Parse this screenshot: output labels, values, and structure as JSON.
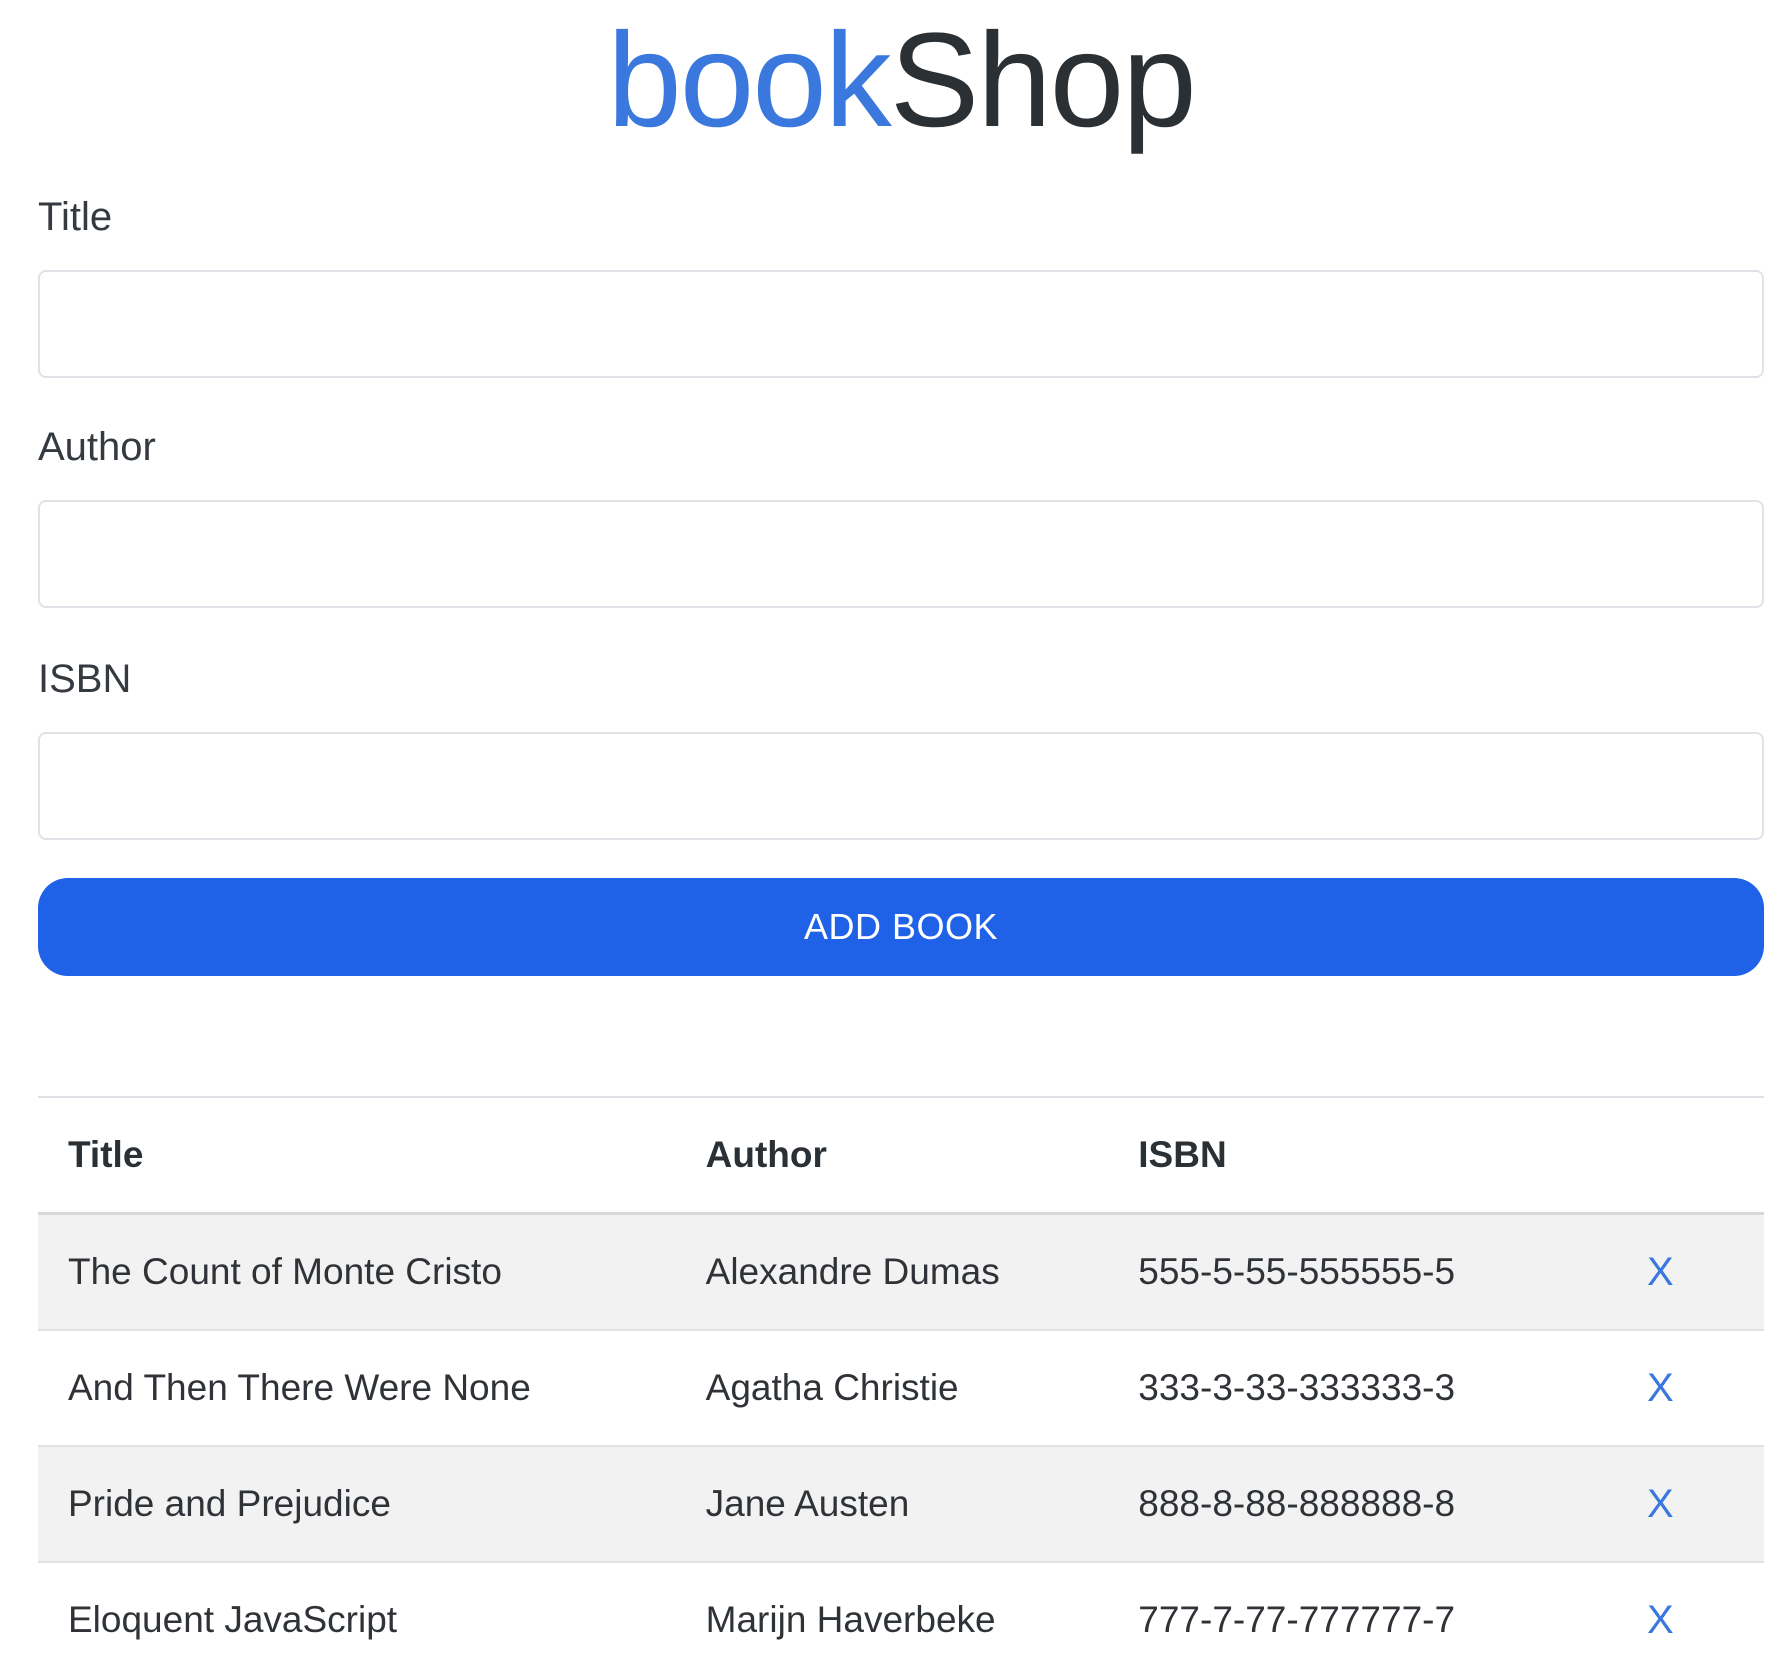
{
  "brand": {
    "part1": "book",
    "part2": "Shop",
    "colors": {
      "part1": "#3a78de",
      "part2": "#2b3035"
    }
  },
  "form": {
    "title_label": "Title",
    "title_value": "",
    "author_label": "Author",
    "author_value": "",
    "isbn_label": "ISBN",
    "isbn_value": "",
    "submit_label": "ADD BOOK",
    "submit_color": "#1f62e7"
  },
  "table": {
    "headers": [
      "Title",
      "Author",
      "ISBN"
    ],
    "rows": [
      {
        "title": "The Count of Monte Cristo",
        "author": "Alexandre Dumas",
        "isbn": "555-5-55-555555-5",
        "delete": "X"
      },
      {
        "title": "And Then There Were None",
        "author": "Agatha Christie",
        "isbn": "333-3-33-333333-3",
        "delete": "X"
      },
      {
        "title": "Pride and Prejudice",
        "author": "Jane Austen",
        "isbn": "888-8-88-888888-8",
        "delete": "X"
      },
      {
        "title": "Eloquent JavaScript",
        "author": "Marijn Haverbeke",
        "isbn": "777-7-77-777777-7",
        "delete": "X"
      }
    ],
    "delete_icon": "close-x-glyph",
    "stripe_color": "#f2f2f2"
  }
}
